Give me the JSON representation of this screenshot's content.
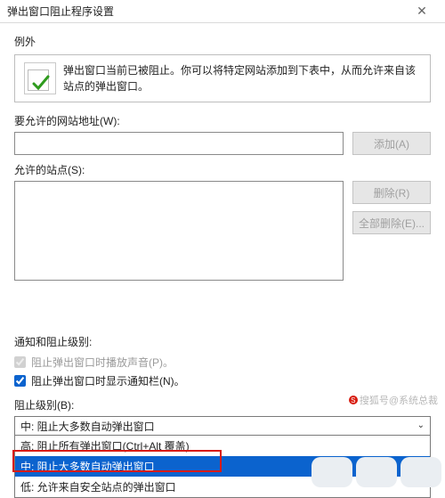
{
  "window": {
    "title": "弹出窗口阻止程序设置",
    "close_glyph": "✕"
  },
  "exceptions": {
    "heading": "例外",
    "info": "弹出窗口当前已被阻止。你可以将特定网站添加到下表中，从而允许来自该站点的弹出窗口。"
  },
  "address": {
    "label": "要允许的网站地址(W):",
    "value": "",
    "add_btn": "添加(A)"
  },
  "allowed": {
    "label": "允许的站点(S):",
    "remove_btn": "删除(R)",
    "remove_all_btn": "全部删除(E)..."
  },
  "notify": {
    "heading": "通知和阻止级别:",
    "sound_chk": "阻止弹出窗口时播放声音(P)。",
    "sound_checked": true,
    "bar_chk": "阻止弹出窗口时显示通知栏(N)。",
    "bar_checked": true
  },
  "level": {
    "label": "阻止级别(B):",
    "selected": "中: 阻止大多数自动弹出窗口",
    "options": {
      "high": "高: 阻止所有弹出窗口(Ctrl+Alt 覆盖)",
      "medium": "中: 阻止大多数自动弹出窗口",
      "low": "低: 允许来自安全站点的弹出窗口"
    }
  },
  "watermark": "搜狐号@系统总裁"
}
